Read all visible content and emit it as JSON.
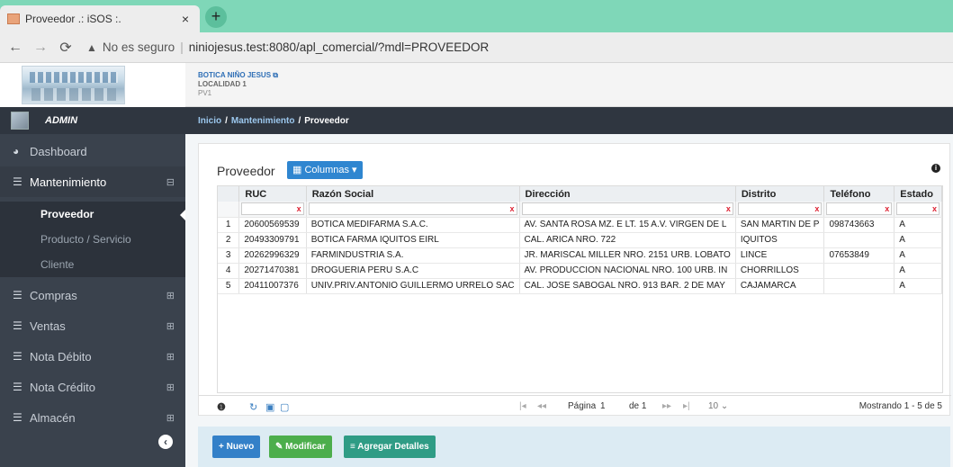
{
  "browser": {
    "tab_title": "Proveedor .: iSOS :.",
    "tab_close": "×",
    "new_tab": "+",
    "not_secure": "No es seguro",
    "url": "niniojesus.test:8080/apl_comercial/?mdl=PROVEEDOR"
  },
  "header": {
    "company_name": "BOTICA NIÑO JESUS",
    "location": "LOCALIDAD 1",
    "pv": "PV1"
  },
  "user": {
    "name": "ADMIN"
  },
  "breadcrumb": {
    "home": "Inicio",
    "section": "Mantenimiento",
    "current": "Proveedor",
    "sep": "/"
  },
  "sidebar": {
    "items": [
      {
        "label": "Dashboard",
        "icon": "tachometer-icon"
      },
      {
        "label": "Mantenimiento",
        "icon": "list-icon",
        "toggle": "⊟"
      },
      {
        "label": "Compras",
        "icon": "list-icon",
        "toggle": "⊞"
      },
      {
        "label": "Ventas",
        "icon": "list-icon",
        "toggle": "⊞"
      },
      {
        "label": "Nota Débito",
        "icon": "list-icon",
        "toggle": "⊞"
      },
      {
        "label": "Nota Crédito",
        "icon": "list-icon",
        "toggle": "⊞"
      },
      {
        "label": "Almacén",
        "icon": "list-icon",
        "toggle": "⊞"
      }
    ],
    "sub_items": [
      {
        "label": "Proveedor"
      },
      {
        "label": "Producto / Servicio"
      },
      {
        "label": "Cliente"
      }
    ]
  },
  "panel": {
    "title": "Proveedor",
    "columns_button": "Columnas",
    "columns": [
      "RUC",
      "Razón Social",
      "Dirección",
      "Distrito",
      "Teléfono",
      "Estado"
    ],
    "rows": [
      {
        "n": "1",
        "ruc": "20600569539",
        "razon": "BOTICA MEDIFARMA S.A.C.",
        "direccion": "AV. SANTA ROSA MZ. E LT. 15 A.V. VIRGEN DE L",
        "distrito": "SAN MARTIN DE P",
        "telefono": "098743663",
        "estado": "A"
      },
      {
        "n": "2",
        "ruc": "20493309791",
        "razon": "BOTICA FARMA IQUITOS EIRL",
        "direccion": "CAL. ARICA NRO. 722",
        "distrito": "IQUITOS",
        "telefono": "",
        "estado": "A"
      },
      {
        "n": "3",
        "ruc": "20262996329",
        "razon": "FARMINDUSTRIA S.A.",
        "direccion": "JR. MARISCAL MILLER NRO. 2151 URB. LOBATO",
        "distrito": "LINCE",
        "telefono": "07653849",
        "estado": "A"
      },
      {
        "n": "4",
        "ruc": "20271470381",
        "razon": "DROGUERIA PERU S.A.C",
        "direccion": "AV. PRODUCCION NACIONAL NRO. 100 URB. IN",
        "distrito": "CHORRILLOS",
        "telefono": "",
        "estado": "A"
      },
      {
        "n": "5",
        "ruc": "20411007376",
        "razon": "UNIV.PRIV.ANTONIO GUILLERMO URRELO SAC",
        "direccion": "CAL. JOSE SABOGAL NRO. 913 BAR. 2 DE MAY",
        "distrito": "CAJAMARCA",
        "telefono": "",
        "estado": "A"
      }
    ],
    "filter_clear": "x"
  },
  "pager": {
    "page_label": "Página",
    "page_value": "1",
    "of_label": "de 1",
    "page_size": "10",
    "showing": "Mostrando 1 - 5 de 5"
  },
  "actions": {
    "nuevo": "Nuevo",
    "modificar": "Modificar",
    "agregar": "Agregar Detalles"
  }
}
